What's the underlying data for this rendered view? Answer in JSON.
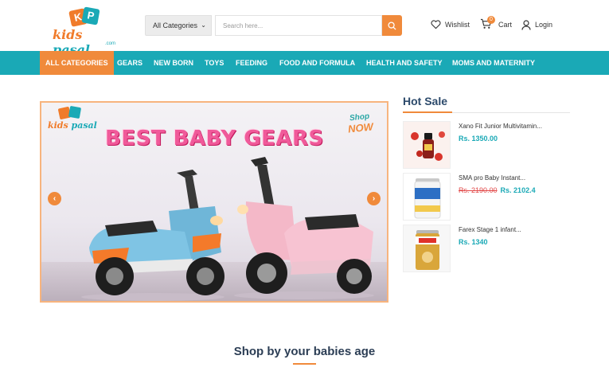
{
  "logo": {
    "letters": [
      "K",
      "P"
    ],
    "word_kids": "kids",
    "word_pasal": "pasal",
    "domain_suffix": ".com"
  },
  "search": {
    "category_selected": "All Categories",
    "placeholder": "Search here..."
  },
  "header_links": {
    "wishlist": "Wishlist",
    "cart": "Cart",
    "cart_count": "0",
    "login": "Login"
  },
  "nav": {
    "items": [
      {
        "label": "ALL CATEGORIES",
        "active": true
      },
      {
        "label": "GEARS"
      },
      {
        "label": "NEW BORN"
      },
      {
        "label": "TOYS"
      },
      {
        "label": "FEEDING"
      },
      {
        "label": "FOOD AND FORMULA"
      },
      {
        "label": "HEALTH AND SAFETY"
      },
      {
        "label": "MOMS AND MATERNITY"
      }
    ]
  },
  "banner": {
    "title": "BEST BABY GEARS",
    "shop_now_top": "Shop",
    "shop_now_bottom": "NOW",
    "prev_arrow": "‹",
    "next_arrow": "›"
  },
  "hot_sale": {
    "title": "Hot Sale",
    "products": [
      {
        "name": "Xano Fit Junior Multivitamin...",
        "price": "Rs. 1350.00"
      },
      {
        "name": "SMA pro Baby Instant...",
        "old_price": "Rs. 2190.00",
        "price": "Rs. 2102.4"
      },
      {
        "name": "Farex Stage 1 infant...",
        "price": "Rs. 1340"
      }
    ]
  },
  "section": {
    "title": "Shop by your babies age"
  },
  "colors": {
    "teal": "#1aa9b6",
    "orange": "#f08a3b",
    "navy": "#2c4a6b"
  }
}
